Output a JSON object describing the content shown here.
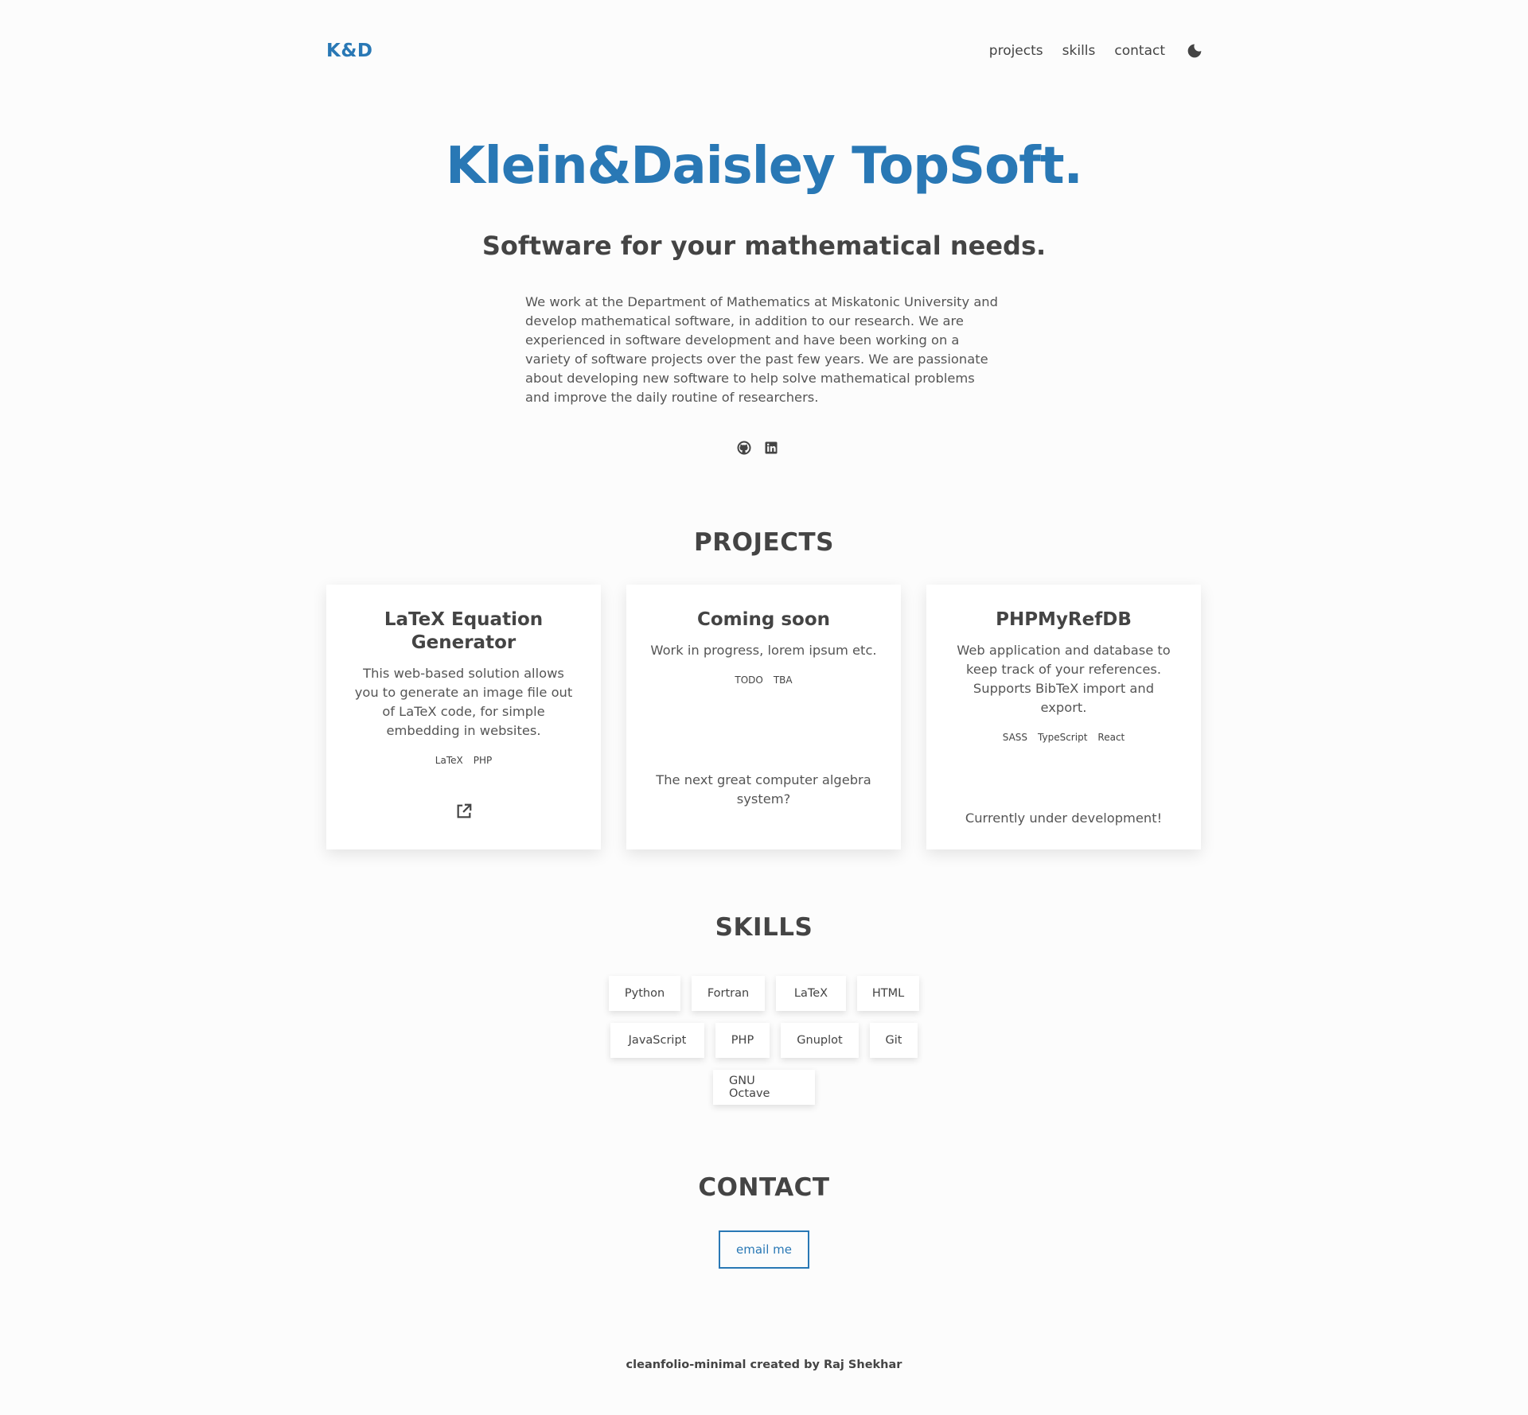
{
  "header": {
    "logo": "K&D",
    "nav": [
      "projects",
      "skills",
      "contact"
    ],
    "theme_icon": "moon-icon"
  },
  "hero": {
    "title": "Klein&Daisley TopSoft.",
    "subtitle": "Software for your mathematical needs.",
    "description": "We work at the Department of Mathematics at Miskatonic University and develop mathematical software, in addition to our research. We are experienced in software development and have been working on a variety of software projects over the past few years. We are passionate about developing new software to help solve mathematical problems and improve the daily routine of researchers.",
    "social_icons": [
      "github-icon",
      "linkedin-icon"
    ]
  },
  "projects": {
    "heading": "PROJECTS",
    "items": [
      {
        "title": "LaTeX Equation Generator",
        "description": "This web-based solution allows you to generate an image file out of LaTeX code, for simple embedding in websites.",
        "tags": [
          "LaTeX",
          "PHP"
        ],
        "link_icon": "external-link-icon"
      },
      {
        "title": "Coming soon",
        "description": "Work in progress, lorem ipsum etc.",
        "tags": [
          "TODO",
          "TBA"
        ],
        "footer": "The next great computer algebra system?"
      },
      {
        "title": "PHPMyRefDB",
        "description": "Web application and database to keep track of your references. Supports BibTeX import and export.",
        "tags": [
          "SASS",
          "TypeScript",
          "React"
        ],
        "footer": "Currently under development!"
      }
    ]
  },
  "skills": {
    "heading": "SKILLS",
    "items": [
      "Python",
      "Fortran",
      "LaTeX",
      "HTML",
      "JavaScript",
      "PHP",
      "Gnuplot",
      "Git",
      "GNU Octave"
    ]
  },
  "contact": {
    "heading": "CONTACT",
    "button": "email me"
  },
  "footer": {
    "text": "cleanfolio-minimal created by Raj Shekhar"
  },
  "colors": {
    "accent": "#2978b5",
    "text": "#444444",
    "background": "#fcfcfc"
  }
}
